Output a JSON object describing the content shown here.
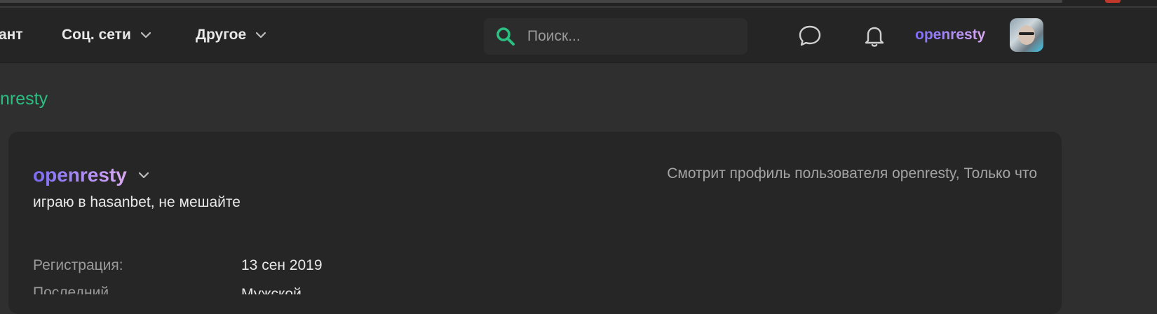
{
  "nav": {
    "items": [
      {
        "label": "ант"
      },
      {
        "label": "Соц. сети"
      },
      {
        "label": "Другое"
      }
    ],
    "search_placeholder": "Поиск...",
    "username": "openresty"
  },
  "breadcrumb": {
    "label": "nresty"
  },
  "profile": {
    "name": "openresty",
    "status": "играю в hasanbet, не мешайте",
    "activity": "Смотрит профиль пользователя openresty, Только что",
    "fields": [
      {
        "label": "Регистрация:",
        "value": "13 сен 2019"
      },
      {
        "label": "Последний...",
        "value": "Мужской"
      }
    ]
  },
  "colors": {
    "accent_green": "#2bbf82",
    "username_gradient_start": "#7b6cf6",
    "username_gradient_end": "#d9a8f2",
    "background": "#2f2f2f",
    "navbar": "#252525",
    "card": "#262626"
  },
  "icons": {
    "search": "search-icon",
    "chat": "chat-bubble-icon",
    "notifications": "bell-icon",
    "dropdown": "chevron-down-icon"
  }
}
